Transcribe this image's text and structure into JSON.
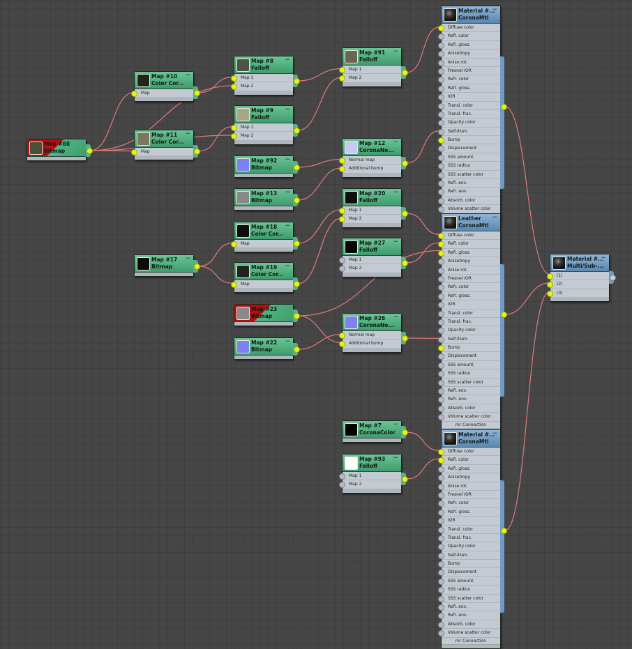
{
  "colors": {
    "wire": "#e27a7a",
    "socket_connected": "#e3f516",
    "map_header": "#4fb483",
    "material_header": "#6f9cc7",
    "error": "#b30f0f"
  },
  "corona_slots": [
    "Diffuse color",
    "Refl. color",
    "Refl. gloss.",
    "Anisotropy",
    "Aniso rot.",
    "Fresnel IOR",
    "Refr. color",
    "Refr. gloss.",
    "IOR",
    "Transl. color",
    "Transl. frac.",
    "Opacity color",
    "Self-illum.",
    "Bump",
    "Displacement",
    "SSS amount",
    "SSS radius",
    "SSS scatter color",
    "Refl. env.",
    "Refr. env.",
    "Absorb. color",
    "Volume scatter color"
  ],
  "mr_connection": "mr Connection",
  "nodes": {
    "map88": {
      "title": "Map #88",
      "type": "Bitmap",
      "swatch": "#4a4f38",
      "error": true,
      "slots": []
    },
    "map10": {
      "title": "Map #10",
      "type": "Color Cor...",
      "swatch": "#22251c",
      "slots": [
        "Map"
      ]
    },
    "map11": {
      "title": "Map #11",
      "type": "Color Cor...",
      "swatch": "#7d7560",
      "slots": [
        "Map"
      ]
    },
    "map8": {
      "title": "Map #8",
      "type": "Falloff",
      "swatch": "#4d5443",
      "slots": [
        "Map 1",
        "Map 2"
      ]
    },
    "map9": {
      "title": "Map #9",
      "type": "Falloff",
      "swatch": "#a6a78a",
      "slots": [
        "Map 1",
        "Map 2"
      ]
    },
    "map91": {
      "title": "Map #91",
      "type": "Falloff",
      "swatch": "#6a6654",
      "slots": [
        "Map 1",
        "Map 2"
      ]
    },
    "map92": {
      "title": "Map #92",
      "type": "Bitmap",
      "swatch": "#7d80f5",
      "slots": []
    },
    "map12": {
      "title": "Map #12",
      "type": "CoronaNo...",
      "swatch": "#c8c8f5",
      "slots": [
        "Normal map",
        "Additional bump"
      ]
    },
    "map13": {
      "title": "Map #13",
      "type": "Bitmap",
      "swatch": "#888888",
      "slots": []
    },
    "map20": {
      "title": "Map #20",
      "type": "Falloff",
      "swatch": "#0e0e0e",
      "slots": [
        "Map 1",
        "Map 2"
      ]
    },
    "map18": {
      "title": "Map #18",
      "type": "Color Cor...",
      "swatch": "#0e0e0e",
      "slots": [
        "Map"
      ]
    },
    "map27": {
      "title": "Map #27",
      "type": "Falloff",
      "swatch": "#050505",
      "slots": [
        "Map 1",
        "Map 2"
      ]
    },
    "map17": {
      "title": "Map #17",
      "type": "Bitmap",
      "swatch": "#0a0a0a",
      "slots": []
    },
    "map19": {
      "title": "Map #19",
      "type": "Color Cor...",
      "swatch": "#222222",
      "slots": [
        "Map"
      ]
    },
    "map23": {
      "title": "Map #23",
      "type": "Bitmap",
      "swatch": "#8a8a8a",
      "error": true,
      "slots": []
    },
    "map26": {
      "title": "Map #26",
      "type": "CoronaNo...",
      "swatch": "#7f80f2",
      "slots": [
        "Normal map",
        "Additional bump"
      ]
    },
    "map22": {
      "title": "Map #22",
      "type": "Bitmap",
      "swatch": "#7f80f2",
      "slots": []
    },
    "map7": {
      "title": "Map #7",
      "type": "CoronaColor",
      "swatch": "#000000",
      "slots": []
    },
    "map93": {
      "title": "Map #93",
      "type": "Falloff",
      "swatch": "#ffffff",
      "slots": [
        "Map 1",
        "Map 2"
      ]
    },
    "mat1": {
      "title": "Material #...",
      "type": "CoronaMtl",
      "material": true,
      "corona": true
    },
    "leather": {
      "title": "Leather",
      "type": "CoronaMtl",
      "material": true,
      "corona": true
    },
    "mat3": {
      "title": "Material #...",
      "type": "CoronaMtl",
      "material": true,
      "corona": true
    },
    "multi": {
      "title": "Material #...",
      "type": "Multi/Sub-...",
      "material": true,
      "slots": [
        "(1)",
        "(2)",
        "(3)"
      ],
      "output_connected": false
    }
  },
  "connections": [
    [
      "map88",
      "map10",
      0
    ],
    [
      "map88",
      "map11",
      0
    ],
    [
      "map88",
      "map8",
      1
    ],
    [
      "map88",
      "map9",
      1
    ],
    [
      "map10",
      "map8",
      0
    ],
    [
      "map11",
      "map9",
      0
    ],
    [
      "map8",
      "map91",
      0
    ],
    [
      "map9",
      "map91",
      1
    ],
    [
      "map91",
      "mat1",
      0
    ],
    [
      "map92",
      "map12",
      0
    ],
    [
      "map13",
      "map12",
      1
    ],
    [
      "map12",
      "mat1",
      13
    ],
    [
      "map17",
      "map18",
      0
    ],
    [
      "map17",
      "map19",
      0
    ],
    [
      "map18",
      "map20",
      0
    ],
    [
      "map19",
      "map20",
      1
    ],
    [
      "map20",
      "leather",
      0
    ],
    [
      "map27",
      "leather",
      1
    ],
    [
      "map23",
      "leather",
      2
    ],
    [
      "map22",
      "map26",
      0
    ],
    [
      "map23",
      "map26",
      1
    ],
    [
      "map26",
      "leather",
      13
    ],
    [
      "map7",
      "mat3",
      0
    ],
    [
      "map93",
      "mat3",
      1
    ],
    [
      "mat1",
      "multi",
      0
    ],
    [
      "leather",
      "multi",
      1
    ],
    [
      "mat3",
      "multi",
      2
    ]
  ]
}
